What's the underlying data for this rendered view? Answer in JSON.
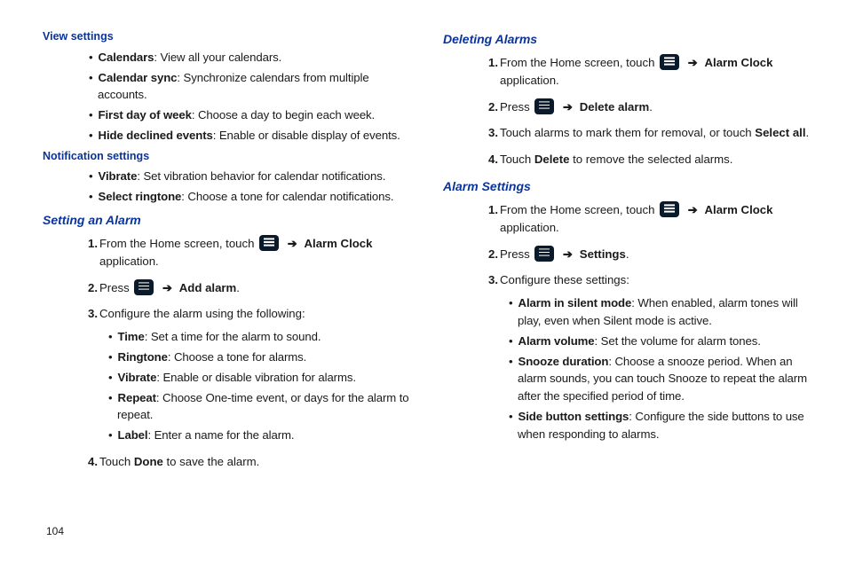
{
  "page_number": "104",
  "left": {
    "view_settings": {
      "title": "View settings",
      "items": [
        {
          "term": "Calendars",
          "desc": ": View all your calendars."
        },
        {
          "term": "Calendar sync",
          "desc": ": Synchronize calendars from multiple accounts."
        },
        {
          "term": "First day of week",
          "desc": ": Choose a day to begin each week."
        },
        {
          "term": "Hide declined events",
          "desc": ": Enable or disable display of events."
        }
      ]
    },
    "notification_settings": {
      "title": "Notification settings",
      "items": [
        {
          "term": "Vibrate",
          "desc": ": Set vibration behavior for calendar notifications."
        },
        {
          "term": "Select ringtone",
          "desc": ": Choose a tone for calendar notifications."
        }
      ]
    },
    "setting_alarm": {
      "title": "Setting an Alarm",
      "step1_a": "From the Home screen, touch ",
      "step1_b": " Alarm Clock",
      "step1_c": " application.",
      "step2_a": "Press ",
      "step2_b": " Add alarm",
      "step2_end": ".",
      "step3": "Configure the alarm using the following:",
      "step3_items": [
        {
          "term": "Time",
          "desc": ": Set a time for the alarm to sound."
        },
        {
          "term": "Ringtone",
          "desc": ": Choose a tone for alarms."
        },
        {
          "term": "Vibrate",
          "desc": ": Enable or disable vibration for alarms."
        },
        {
          "term": "Repeat",
          "desc": ": Choose One-time event, or days for the alarm to repeat."
        },
        {
          "term": "Label",
          "desc": ": Enter a name for the alarm."
        }
      ],
      "step4_a": "Touch ",
      "step4_b": "Done",
      "step4_c": " to save the alarm."
    }
  },
  "right": {
    "deleting_alarms": {
      "title": "Deleting Alarms",
      "step1_a": "From the Home screen, touch ",
      "step1_b": " Alarm Clock",
      "step1_c": " application.",
      "step2_a": "Press ",
      "step2_b": " Delete alarm",
      "step2_end": ".",
      "step3_a": "Touch alarms to mark them for removal, or touch ",
      "step3_b": "Select all",
      "step3_c": ".",
      "step4_a": "Touch ",
      "step4_b": "Delete",
      "step4_c": " to remove the selected alarms."
    },
    "alarm_settings": {
      "title": "Alarm Settings",
      "step1_a": "From the Home screen, touch ",
      "step1_b": " Alarm Clock",
      "step1_c": " application.",
      "step2_a": "Press ",
      "step2_b": " Settings",
      "step2_end": ".",
      "step3": "Configure these settings:",
      "step3_items": [
        {
          "term": "Alarm in silent mode",
          "desc": ": When enabled, alarm tones will play, even when Silent mode is active."
        },
        {
          "term": "Alarm volume",
          "desc": ": Set the volume for alarm tones."
        },
        {
          "term": "Snooze duration",
          "desc": ": Choose a snooze period. When an alarm sounds, you can touch Snooze to repeat the alarm after the specified period of time."
        },
        {
          "term": "Side button settings",
          "desc": ": Configure the side buttons to use when responding to alarms."
        }
      ]
    }
  },
  "arrow_glyph": "➔"
}
